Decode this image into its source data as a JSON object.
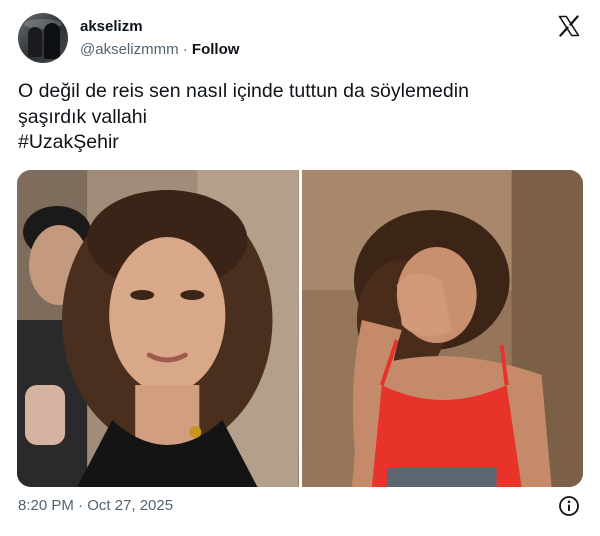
{
  "user": {
    "display_name": "akselizm",
    "handle": "@akselizmmm",
    "separator": "·",
    "follow_label": "Follow"
  },
  "tweet": {
    "line1": "O değil de reis sen nasıl içinde tuttun da söylemedin",
    "line2": "şaşırdık vallahi",
    "hashtag": "#UzakŞehir"
  },
  "meta": {
    "timestamp": "8:20 PM · Oct 27, 2025"
  },
  "icons": {
    "brand": "x-logo-icon",
    "info": "info-icon"
  },
  "colors": {
    "text": "#0f1419",
    "secondary": "#536471",
    "red_top": "#e8332b"
  }
}
